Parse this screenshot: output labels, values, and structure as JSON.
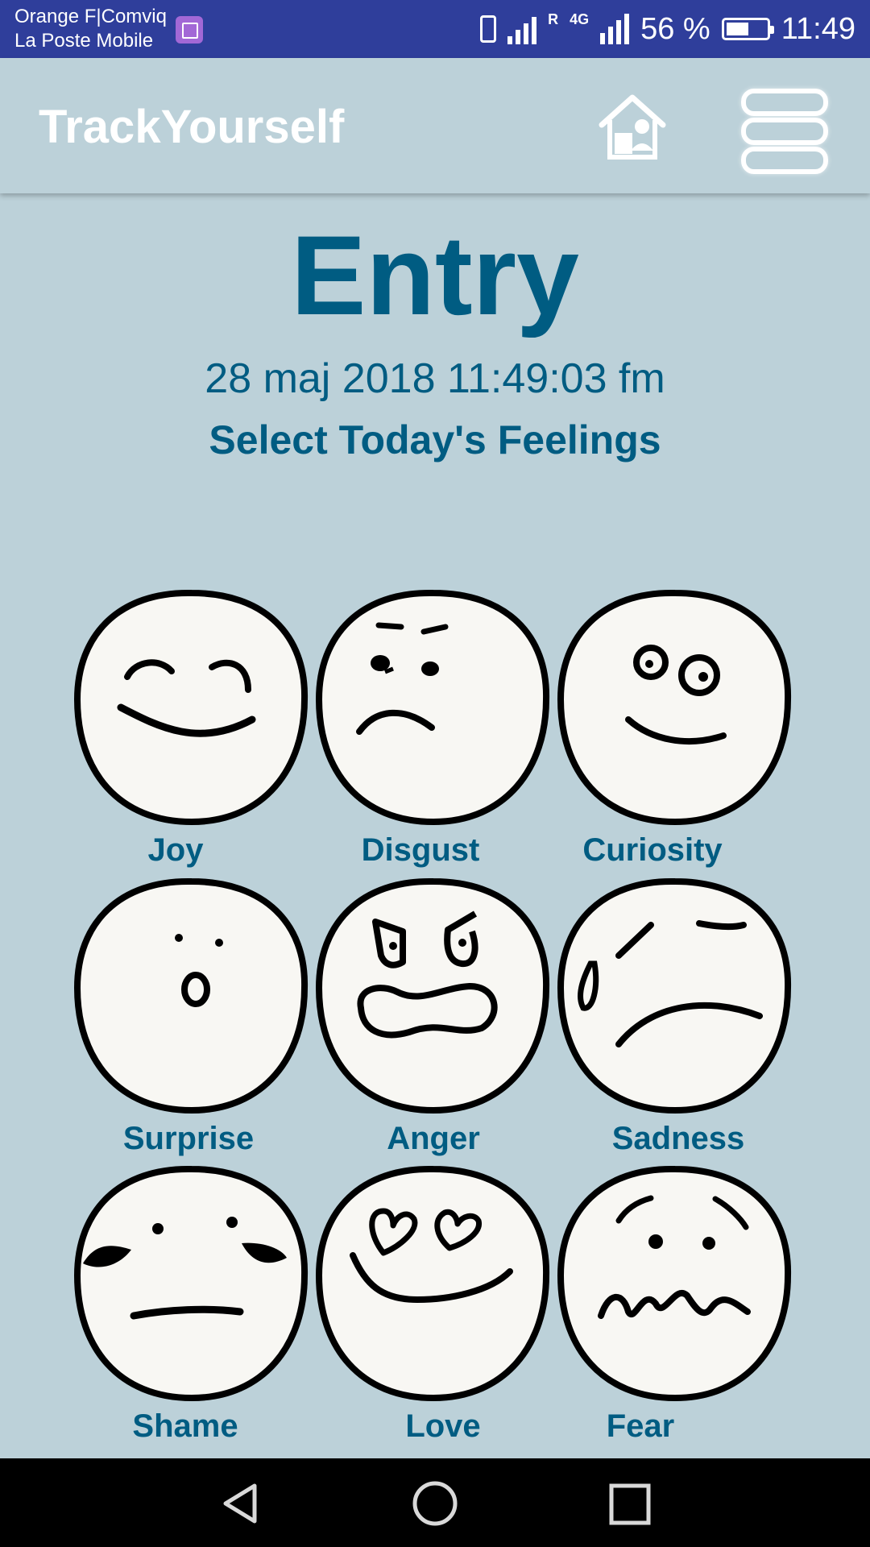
{
  "status_bar": {
    "carrier_line1": "Orange F|Comviq",
    "carrier_line2": "La Poste Mobile",
    "roaming_label": "R",
    "network_label": "4G",
    "battery_percent": "56 %",
    "battery_level": 0.56,
    "time": "11:49"
  },
  "app_bar": {
    "title": "TrackYourself",
    "home_icon": "home-icon",
    "menu_icon": "hamburger-menu-icon"
  },
  "page": {
    "heading": "Entry",
    "datetime": "28 maj 2018 11:49:03 fm",
    "subheading": "Select Today's Feelings"
  },
  "feelings": [
    {
      "label": "Joy",
      "icon": "joy-face-icon"
    },
    {
      "label": "Disgust",
      "icon": "disgust-face-icon"
    },
    {
      "label": "Curiosity",
      "icon": "curiosity-face-icon"
    },
    {
      "label": "Surprise",
      "icon": "surprise-face-icon"
    },
    {
      "label": "Anger",
      "icon": "anger-face-icon"
    },
    {
      "label": "Sadness",
      "icon": "sadness-face-icon"
    },
    {
      "label": "Shame",
      "icon": "shame-face-icon"
    },
    {
      "label": "Love",
      "icon": "love-face-icon"
    },
    {
      "label": "Fear",
      "icon": "fear-face-icon"
    }
  ],
  "nav_bar": {
    "back_icon": "back-triangle-icon",
    "home_icon": "home-circle-icon",
    "recents_icon": "recents-square-icon"
  },
  "colors": {
    "background": "#bcd1d9",
    "status_bar": "#2f3e9b",
    "accent_text": "#005c82",
    "face_fill": "#f8f7f3"
  }
}
